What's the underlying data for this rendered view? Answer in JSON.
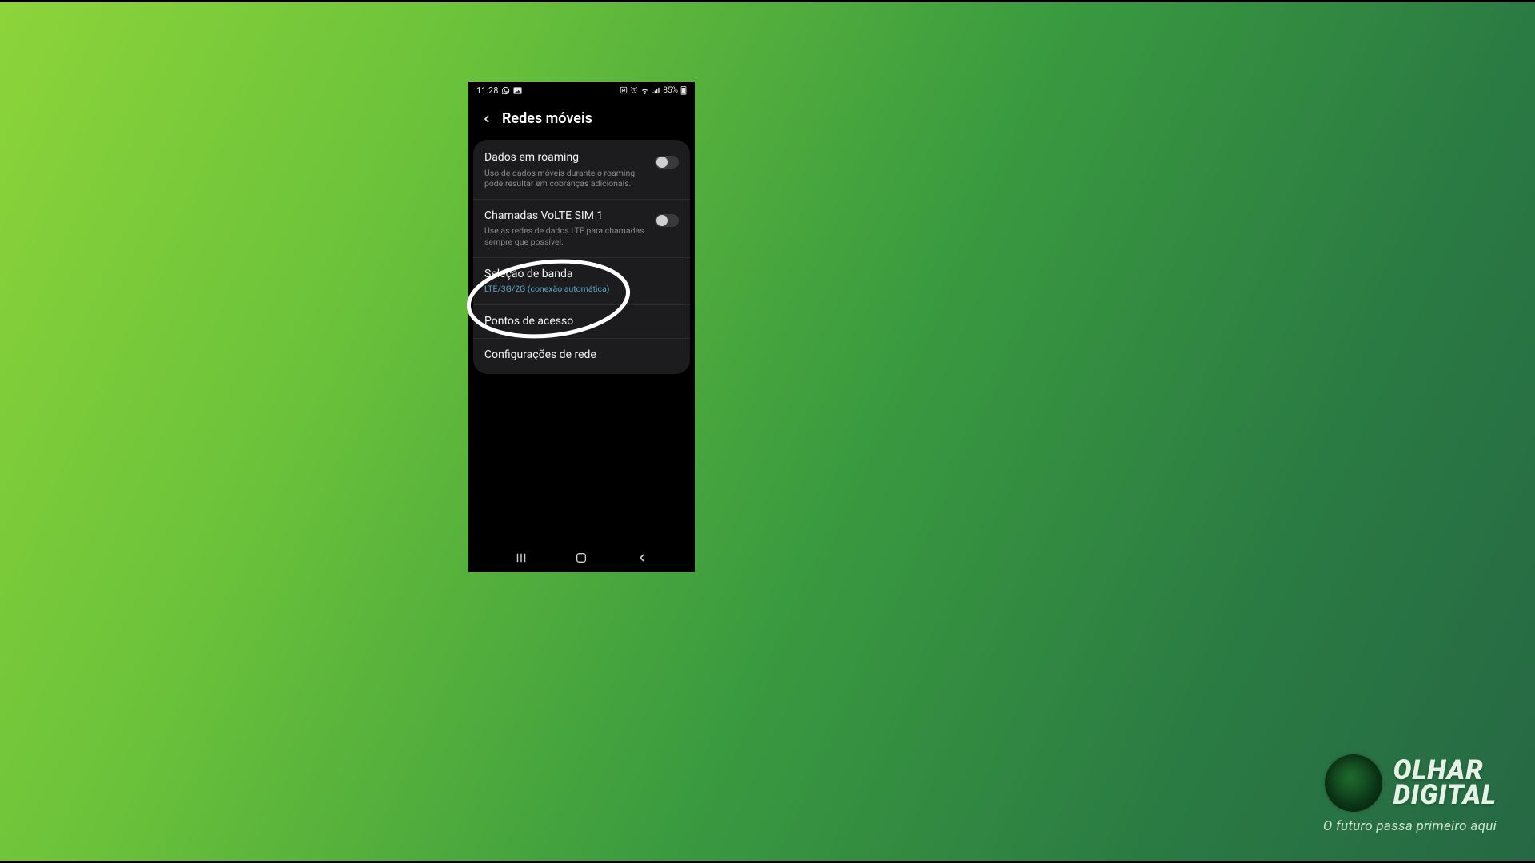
{
  "status": {
    "time": "11:28",
    "battery_text": "85%"
  },
  "header": {
    "title": "Redes móveis"
  },
  "settings": {
    "roaming": {
      "title": "Dados em roaming",
      "sub": "Uso de dados móveis durante o roaming pode resultar em cobranças adicionais."
    },
    "volte": {
      "title": "Chamadas VoLTE SIM 1",
      "sub": "Use as redes de dados LTE para chamadas sempre que possível."
    },
    "band": {
      "title": "Seleção de banda",
      "sub": "LTE/3G/2G (conexão automática)"
    },
    "apn": {
      "title": "Pontos de acesso"
    },
    "netcfg": {
      "title": "Configurações de rede"
    }
  },
  "brand": {
    "line1": "OLHAR",
    "line2": "DIGITAL",
    "tagline": "O futuro passa primeiro aqui"
  }
}
